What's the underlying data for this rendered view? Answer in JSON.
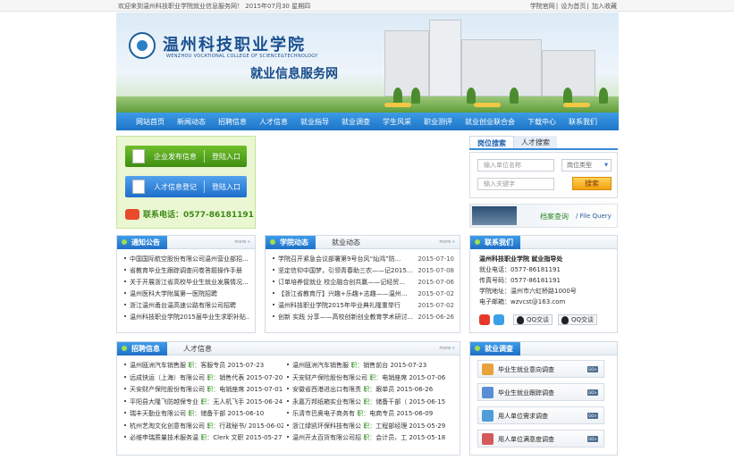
{
  "topbar": {
    "welcome": "欢迎来到温州科技职业学院就业信息服务网！ 2015年07月30 星期四",
    "links": [
      "学院官网",
      "设为首页",
      "加入收藏"
    ]
  },
  "banner": {
    "school_name": "温州科技职业学院",
    "school_name_en": "WENZHOU VOCATIONAL COLLEGE OF SCIENCE&TECHNOLOGY",
    "subtitle": "就业信息服务网"
  },
  "nav": [
    "网站首页",
    "新闻动态",
    "招聘信息",
    "人才信息",
    "就业指导",
    "就业调查",
    "学生风采",
    "职业测评",
    "就业创业联合会",
    "下载中心",
    "联系我们"
  ],
  "entry": {
    "company_label": "企业发布信息",
    "company_login": "登陆入口",
    "talent_label": "人才信息登记",
    "talent_login": "登陆入口",
    "phone": "联系电话：0577-86181191"
  },
  "search": {
    "tab_active": "岗位搜索",
    "tab_other": "人才搜索",
    "company_placeholder": "输入单位名称",
    "type_select": "岗位类型",
    "keyword_placeholder": "输入关键字",
    "button": "搜索"
  },
  "file_query": {
    "cn": "档案查询",
    "en": "/ File Query"
  },
  "notice": {
    "title": "通知公告",
    "more": "more",
    "items": [
      "中国国际航空股份有限公司温州营业部招...",
      "省教育毕业生跟踪调查问卷答题操作手册",
      "关于开展浙江省高校毕业生就业发展情况...",
      "温州医科大学附属第一医院招聘",
      "浙江温州甬台温高速公路有限公司招聘",
      "温州科技职业学院2015届毕业生求职补贴..."
    ]
  },
  "news": {
    "tab_active": "学院动态",
    "tab_other": "就业动态",
    "more": "more",
    "items": [
      {
        "title": "学院召开紧急会议部署第9号台风“灿鸿”防...",
        "date": "2015-07-10"
      },
      {
        "title": "坚定信仰中国梦，引领青春助三农——记2015...",
        "date": "2015-07-08"
      },
      {
        "title": "订单培养促就业 校企融合创共赢——记经贸...",
        "date": "2015-07-06"
      },
      {
        "title": "【浙江省教育厅】兴趣+乐趣+志趣——温州...",
        "date": "2015-07-02"
      },
      {
        "title": "温州科技职业学院2015年毕业典礼隆重举行",
        "date": "2015-07-02"
      },
      {
        "title": "创新 实践 分享——高校创新创业教育学术研讨...",
        "date": "2015-06-26"
      }
    ]
  },
  "contact": {
    "title": "联系我们",
    "org": "温州科技职业学院 就业指导处",
    "phone": "就业电话：0577-86181191",
    "fax": "传真号码：0577-86181191",
    "address": "学院地址：温州市六虹桥路1000号",
    "email": "电子邮箱：wzvcst@163.com",
    "qq1": "QQ交谈",
    "qq2": "QQ交谈"
  },
  "hiring": {
    "tab_active": "招聘信息",
    "tab_other": "人才信息",
    "more": "more",
    "left": [
      {
        "company": "温州瓯洲汽车销售服",
        "pos_label": "职：",
        "pos": "客服专员",
        "date": "2015-07-23"
      },
      {
        "company": "远成快运（上海）有限公司",
        "pos_label": "职：",
        "pos": "销售代表",
        "date": "2015-07-20"
      },
      {
        "company": "天安财产保险股份有限公司",
        "pos_label": "职：",
        "pos": "电销座席",
        "date": "2015-07-01"
      },
      {
        "company": "平阳县大隆飞防越保专业",
        "pos_label": "职：",
        "pos": "无人机飞手",
        "date": "2015-06-24"
      },
      {
        "company": "瑞丰天勤业有限公司",
        "pos_label": "职：",
        "pos": "储备干部",
        "date": "2015-06-10"
      },
      {
        "company": "杭州艺淘文化创意有限公司",
        "pos_label": "职：",
        "pos": "行政秘书/",
        "date": "2015-06-02"
      },
      {
        "company": "必维申瑞质量技术服务温",
        "pos_label": "职：",
        "pos": "Clerk 文职",
        "date": "2015-05-27"
      }
    ],
    "right": [
      {
        "company": "温州瓯洲汽车销售服",
        "pos_label": "职：",
        "pos": "销售前台",
        "date": "2015-07-23"
      },
      {
        "company": "天安财产保险股份有限公司",
        "pos_label": "职：",
        "pos": "电销座席",
        "date": "2015-07-06"
      },
      {
        "company": "安徽省西港进出口有限责",
        "pos_label": "职：",
        "pos": "跟单员",
        "date": "2015-06-26"
      },
      {
        "company": "永嘉万邦纸箱实业有限公",
        "pos_label": "职：",
        "pos": "储备干部（",
        "date": "2015-06-15"
      },
      {
        "company": "乐清市巴奥电子商务有",
        "pos_label": "职：",
        "pos": "电商专员",
        "date": "2015-06-09"
      },
      {
        "company": "浙江绿凯环保科技有限公",
        "pos_label": "职：",
        "pos": "工程部经理",
        "date": "2015-05-29"
      },
      {
        "company": "温州开太百货有限公司招",
        "pos_label": "职：",
        "pos": "会计员、工",
        "date": "2015-05-18"
      }
    ]
  },
  "survey": {
    "title": "就业调查",
    "items": [
      "毕业生就业意向调查",
      "毕业生就业跟踪调查",
      "用人单位需求调查",
      "用人单位满意度调查"
    ],
    "badge": "GO>"
  }
}
